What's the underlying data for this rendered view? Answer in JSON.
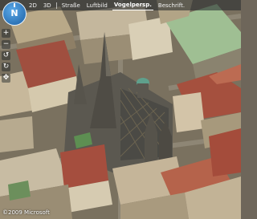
{
  "toolbar": {
    "compass_label": "N",
    "tabs": [
      {
        "label": "2D"
      },
      {
        "label": "3D"
      },
      {
        "label": "Straße"
      },
      {
        "label": "Luftbild"
      },
      {
        "label": "Vogelpersp.",
        "active": true
      },
      {
        "label": "Beschrift."
      }
    ]
  },
  "sidebar": {
    "buttons": [
      {
        "icon": "zoom-in-icon",
        "glyph": "+"
      },
      {
        "icon": "zoom-out-icon",
        "glyph": "−"
      },
      {
        "icon": "rotate-left-icon",
        "glyph": "↺"
      },
      {
        "icon": "rotate-right-icon",
        "glyph": "↻"
      },
      {
        "icon": "pan-icon",
        "glyph": "✥"
      }
    ]
  },
  "footer": {
    "attribution": "©2009 Microsoft"
  },
  "colors": {
    "accent": "#2a78c8",
    "toolbar": "#1e2228"
  }
}
